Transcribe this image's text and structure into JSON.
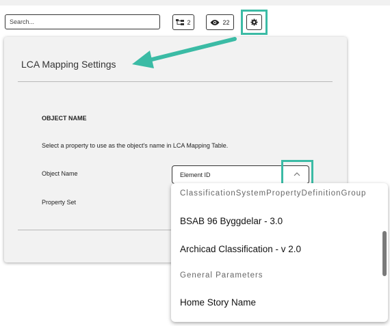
{
  "toolbar": {
    "search_placeholder": "Search...",
    "hierarchy_count": "2",
    "visible_count": "22"
  },
  "panel": {
    "title": "LCA Mapping Settings",
    "section_title": "OBJECT NAME",
    "description": "Select a property to use as the object's name in LCA Mapping Table.",
    "object_name_label": "Object Name",
    "object_name_value": "Element ID",
    "property_set_label": "Property Set"
  },
  "dropdown": {
    "options": [
      {
        "type": "group",
        "label": "ClassificationSystemPropertyDefinitionGroup"
      },
      {
        "type": "item",
        "label": "BSAB 96 Byggdelar - 3.0"
      },
      {
        "type": "item",
        "label": "Archicad Classification - v 2.0"
      },
      {
        "type": "group",
        "label": "General Parameters"
      },
      {
        "type": "item",
        "label": "Home Story Name"
      }
    ]
  },
  "annotations": {
    "accent_color": "#3bbba5"
  }
}
